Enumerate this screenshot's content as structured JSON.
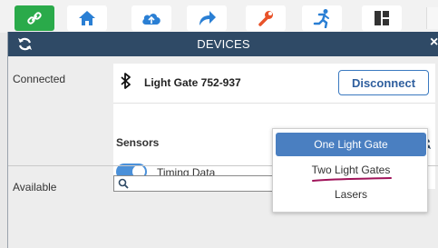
{
  "toolbar": {
    "buttons": [
      {
        "icon": "link-icon",
        "bg": "#2aaa4a"
      },
      {
        "icon": "home-icon",
        "bg": "#ffffff"
      },
      {
        "icon": "cloud-icon",
        "bg": "#ffffff"
      },
      {
        "icon": "share-icon",
        "bg": "#ffffff"
      },
      {
        "icon": "wrench-icon",
        "bg": "#ffffff"
      },
      {
        "icon": "running-icon",
        "bg": "#ffffff"
      },
      {
        "icon": "layout-icon",
        "bg": "#ffffff"
      }
    ]
  },
  "panel": {
    "title": "DEVICES",
    "close": "×"
  },
  "connected": {
    "label": "Connected",
    "device_name": "Light Gate 752-937",
    "disconnect_label": "Disconnect",
    "sensors_label": "Sensors",
    "timing_data_label": "Timing Data",
    "timing_data_on": true
  },
  "available": {
    "label": "Available",
    "search_value": ""
  },
  "dropdown": {
    "options": [
      "One Light Gate",
      "Two Light Gates",
      "Lasers"
    ],
    "selected": "One Light Gate"
  },
  "colors": {
    "header": "#2f4a66",
    "accent": "#4a7fc1",
    "green": "#2aaa4a",
    "toolbar_icon": "#2a7fd4",
    "wrench": "#e8532a",
    "annotation": "#a0145a"
  }
}
